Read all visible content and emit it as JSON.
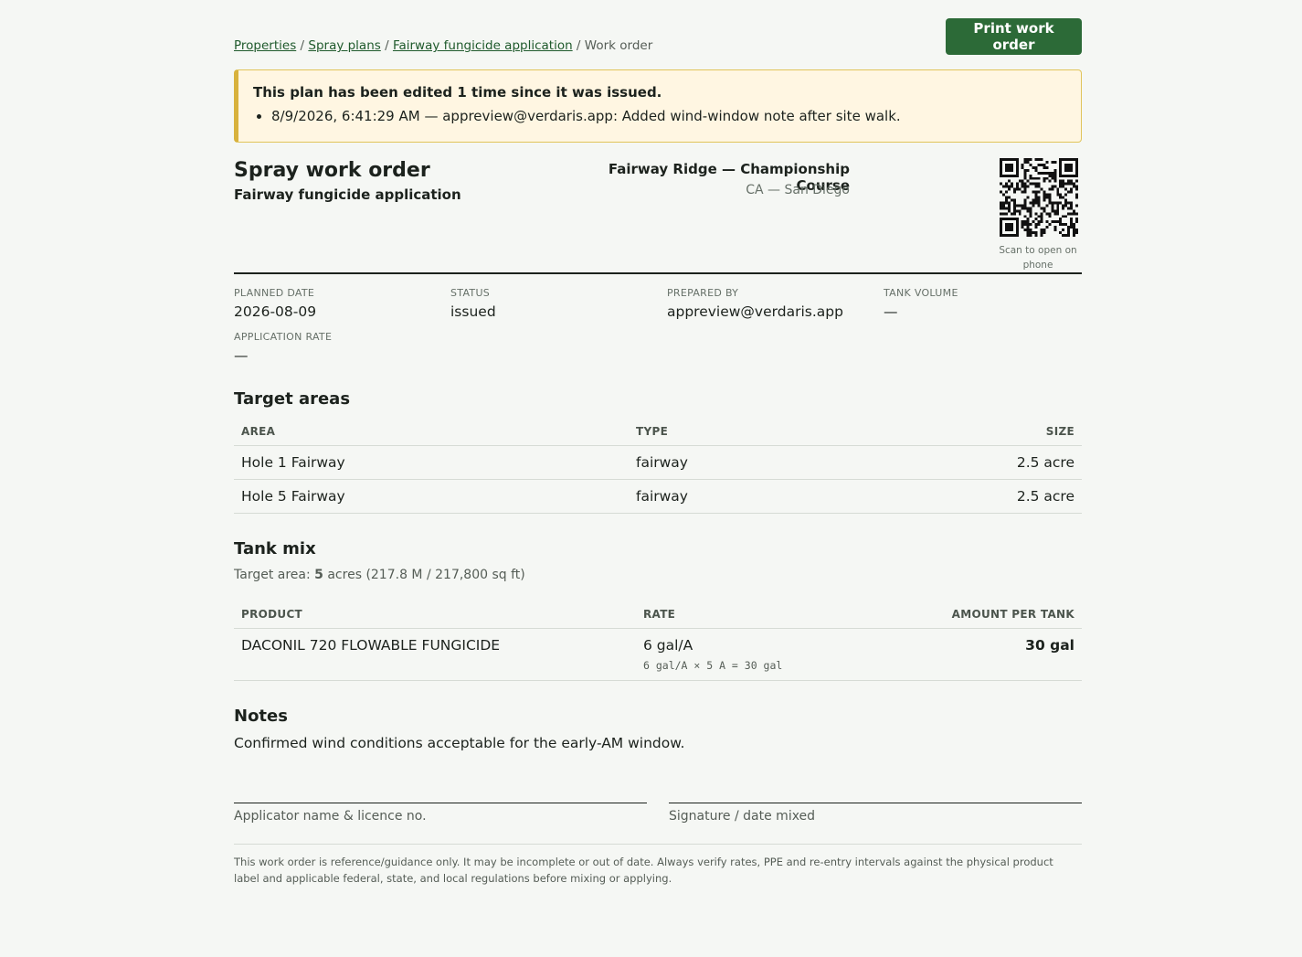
{
  "breadcrumb": {
    "items": [
      "Properties",
      "Spray plans",
      "Fairway fungicide application"
    ],
    "sep": " / ",
    "current": "Work order"
  },
  "actions": {
    "print_label": "Print work order"
  },
  "alert": {
    "title": "This plan has been edited 1 time since it was issued.",
    "entries": [
      "8/9/2026, 6:41:29 AM — appreview@verdaris.app: Added wind-window note after site walk."
    ]
  },
  "header": {
    "title": "Spray work order",
    "subtitle": "Fairway fungicide application",
    "site": "Fairway Ridge — Championship Course",
    "location": "CA — San Diego",
    "qr_caption": "Scan to open on phone"
  },
  "meta": {
    "planned_date": {
      "label": "PLANNED DATE",
      "value": "2026-08-09"
    },
    "status": {
      "label": "STATUS",
      "value": "issued"
    },
    "prepared_by": {
      "label": "PREPARED BY",
      "value": "appreview@verdaris.app"
    },
    "tank_volume": {
      "label": "TANK VOLUME",
      "value": "—"
    },
    "application_rate": {
      "label": "APPLICATION RATE",
      "value": "—"
    }
  },
  "target_areas": {
    "heading": "Target areas",
    "columns": [
      "AREA",
      "TYPE",
      "SIZE"
    ],
    "rows": [
      {
        "area": "Hole 1 Fairway",
        "type": "fairway",
        "size": "2.5 acre"
      },
      {
        "area": "Hole 5 Fairway",
        "type": "fairway",
        "size": "2.5 acre"
      }
    ]
  },
  "tank_mix": {
    "heading": "Tank mix",
    "target_prefix": "Target area: ",
    "target_acres": "5",
    "target_suffix": " acres (217.8 M / 217,800 sq ft)",
    "columns": [
      "PRODUCT",
      "RATE",
      "AMOUNT PER TANK"
    ],
    "rows": [
      {
        "product": "DACONIL 720 FLOWABLE FUNGICIDE",
        "rate": "6 gal/A",
        "calc": "6 gal/A × 5 A = 30 gal",
        "amount": "30 gal"
      }
    ]
  },
  "notes": {
    "heading": "Notes",
    "text": "Confirmed wind conditions acceptable for the early-AM window."
  },
  "signatures": {
    "applicator": "Applicator name & licence no.",
    "signature": "Signature / date mixed"
  },
  "disclaimer": "This work order is reference/guidance only. It may be incomplete or out of date. Always verify rates, PPE and re-entry intervals against the physical product label and applicable federal, state, and local regulations before mixing or applying.",
  "colors": {
    "accent": "#2c6a37",
    "alert_bg": "#fff6e2",
    "alert_border": "#d8b23d"
  }
}
